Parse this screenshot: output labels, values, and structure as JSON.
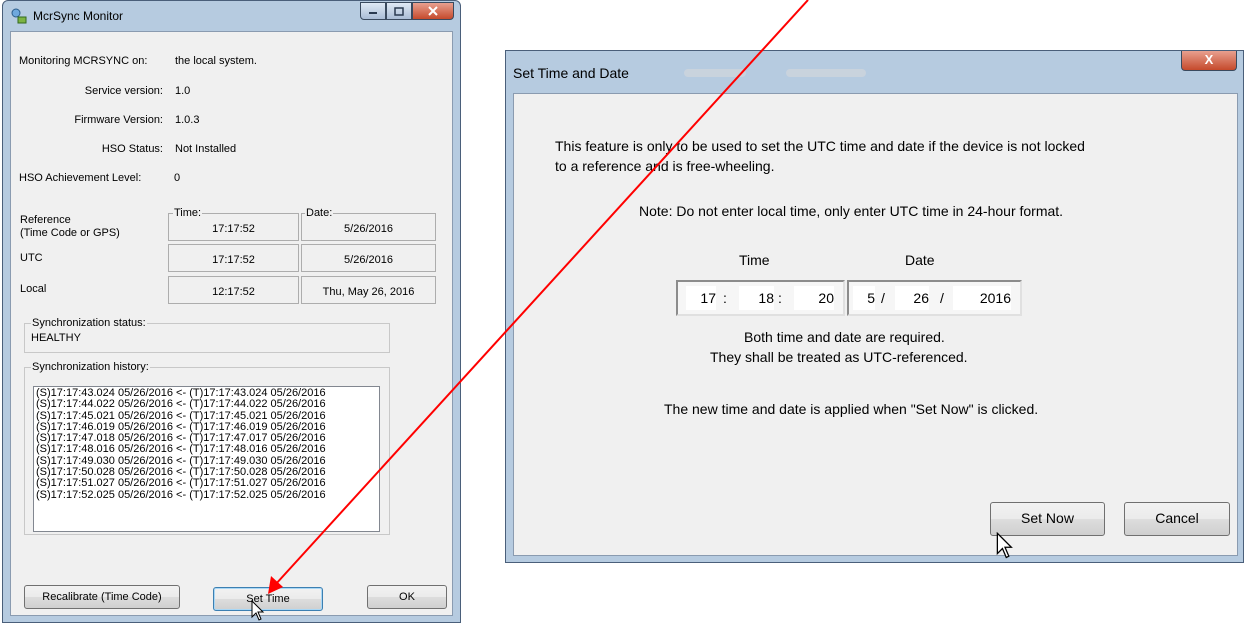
{
  "monitor": {
    "title": "McrSync Monitor",
    "monitoring_label": "Monitoring MCRSYNC on:",
    "monitoring_value": "the local system.",
    "service_version_label": "Service version:",
    "service_version": "1.0",
    "firmware_version_label": "Firmware Version:",
    "firmware_version": "1.0.3",
    "hso_status_label": "HSO Status:",
    "hso_status": "Not Installed",
    "hso_level_label": "HSO Achievement Level:",
    "hso_level": "0",
    "time_header": "Time:",
    "date_header": "Date:",
    "rows": [
      {
        "label": "Reference",
        "sublabel": "(Time Code or GPS)",
        "time": "17:17:52",
        "date": "5/26/2016"
      },
      {
        "label": "UTC",
        "sublabel": "",
        "time": "17:17:52",
        "date": "5/26/2016"
      },
      {
        "label": "Local",
        "sublabel": "",
        "time": "12:17:52",
        "date": "Thu, May 26, 2016"
      }
    ],
    "sync_status_label": "Synchronization status:",
    "sync_status": "HEALTHY",
    "sync_history_label": "Synchronization history:",
    "history": [
      "(S)17:17:43.024 05/26/2016 <- (T)17:17:43.024 05/26/2016",
      "(S)17:17:44.022 05/26/2016 <- (T)17:17:44.022 05/26/2016",
      "(S)17:17:45.021 05/26/2016 <- (T)17:17:45.021 05/26/2016",
      "(S)17:17:46.019 05/26/2016 <- (T)17:17:46.019 05/26/2016",
      "(S)17:17:47.018 05/26/2016 <- (T)17:17:47.017 05/26/2016",
      "(S)17:17:48.016 05/26/2016 <- (T)17:17:48.016 05/26/2016",
      "(S)17:17:49.030 05/26/2016 <- (T)17:17:49.030 05/26/2016",
      "(S)17:17:50.028 05/26/2016 <- (T)17:17:50.028 05/26/2016",
      "(S)17:17:51.027 05/26/2016 <- (T)17:17:51.027 05/26/2016",
      "(S)17:17:52.025 05/26/2016 <- (T)17:17:52.025 05/26/2016"
    ],
    "buttons": {
      "recalibrate": "Recalibrate (Time Code)",
      "set_time": "Set Time",
      "ok": "OK"
    }
  },
  "set_time_dialog": {
    "title": "Set Time and Date",
    "close_glyph": "X",
    "intro_line1": "This feature is only to be used to set the UTC time and date if the device is not locked",
    "intro_line2": "to a reference and is free-wheeling.",
    "note": "Note: Do not enter local time, only enter UTC time in 24-hour format.",
    "time_label": "Time",
    "date_label": "Date",
    "time": {
      "hour": "17",
      "minute": "18",
      "second": "20",
      "separator": ":"
    },
    "date": {
      "month": "5",
      "day": "26",
      "year": "2016",
      "separator": "/"
    },
    "required_line1": "Both time and date are required.",
    "required_line2": "They shall be treated as UTC-referenced.",
    "apply_note": "The new time and date is applied when \"Set Now\" is clicked.",
    "buttons": {
      "set_now": "Set Now",
      "cancel": "Cancel"
    }
  },
  "colors": {
    "annotation_arrow": "#ff0000",
    "window_frame": "#b6cbe0",
    "dialog_bg": "#f0f0f0"
  }
}
